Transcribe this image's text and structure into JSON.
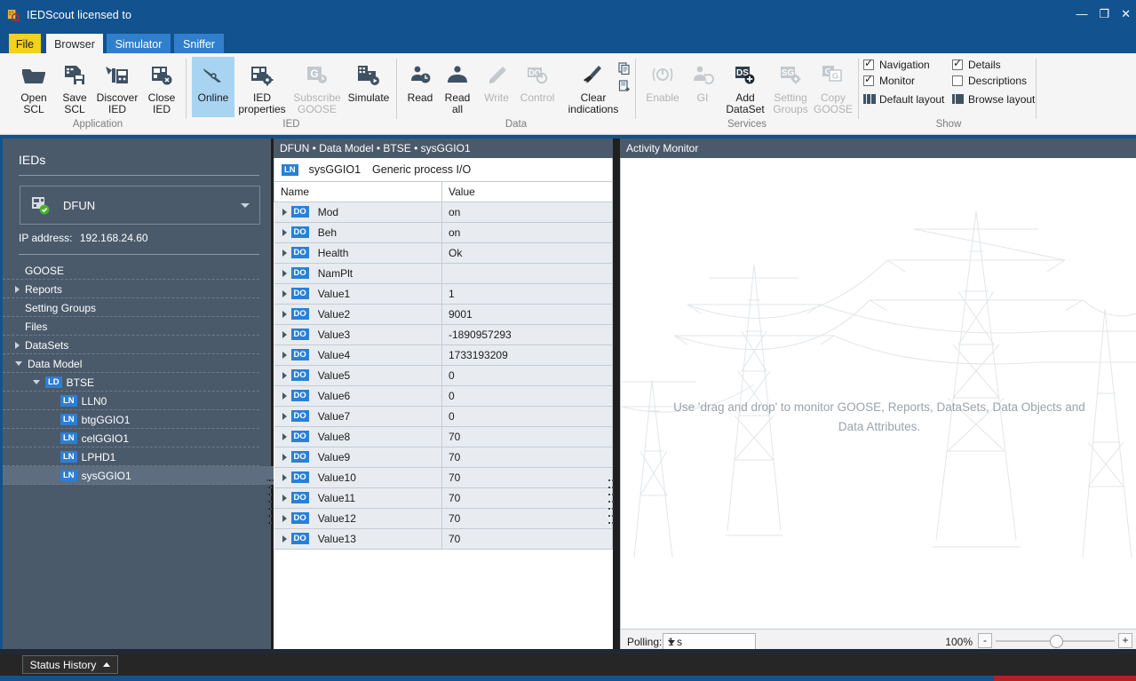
{
  "window": {
    "title": "IEDScout licensed to",
    "icon": "iedscout-logo-icon",
    "minimize": "—",
    "maximize": "❐",
    "close": "✕"
  },
  "help_bar": {
    "info": "info-icon",
    "whats_this": "whats-this-icon",
    "help": "help-icon"
  },
  "tabs": [
    {
      "label": "File",
      "state": "file"
    },
    {
      "label": "Browser",
      "state": "active"
    },
    {
      "label": "Simulator",
      "state": "normal"
    },
    {
      "label": "Sniffer",
      "state": "normal"
    }
  ],
  "ribbon": {
    "groups": [
      {
        "label": "Application"
      },
      {
        "label": "IED"
      },
      {
        "label": "Data"
      },
      {
        "label": "Services"
      },
      {
        "label": "Show"
      }
    ],
    "buttons": [
      {
        "label": "Open\nSCL",
        "icon": "open-folder-icon",
        "enabled": true,
        "selected": false
      },
      {
        "label": "Save\nSCL",
        "icon": "save-document-icon",
        "enabled": true,
        "selected": false
      },
      {
        "label": "Discover\nIED",
        "icon": "discover-ied-icon",
        "enabled": true,
        "selected": false
      },
      {
        "label": "Close\nIED",
        "icon": "close-ied-icon",
        "enabled": true,
        "selected": false
      },
      {
        "label": "Online",
        "icon": "online-plug-icon",
        "enabled": true,
        "selected": true
      },
      {
        "label": "IED\nproperties",
        "icon": "ied-properties-icon",
        "enabled": true,
        "selected": false
      },
      {
        "label": "Subscribe\nGOOSE",
        "icon": "subscribe-goose-icon",
        "enabled": false,
        "selected": false
      },
      {
        "label": "Simulate",
        "icon": "simulate-icon",
        "enabled": true,
        "selected": false
      },
      {
        "label": "Read",
        "icon": "read-icon",
        "enabled": true,
        "selected": false
      },
      {
        "label": "Read\nall",
        "icon": "read-all-icon",
        "enabled": true,
        "selected": false
      },
      {
        "label": "Write",
        "icon": "write-pencil-icon",
        "enabled": false,
        "selected": false
      },
      {
        "label": "Control",
        "icon": "control-icon",
        "enabled": false,
        "selected": false
      },
      {
        "label": "Clear\nindications",
        "icon": "clear-indications-icon",
        "enabled": true,
        "selected": false
      },
      {
        "label": "Enable",
        "icon": "enable-power-icon",
        "enabled": false,
        "selected": false
      },
      {
        "label": "GI",
        "icon": "general-interrogation-icon",
        "enabled": false,
        "selected": false
      },
      {
        "label": "Add\nDataSet",
        "icon": "add-dataset-icon",
        "enabled": true,
        "selected": false
      },
      {
        "label": "Setting\nGroups",
        "icon": "setting-groups-icon",
        "enabled": false,
        "selected": false
      },
      {
        "label": "Copy\nGOOSE",
        "icon": "copy-goose-icon",
        "enabled": false,
        "selected": false
      }
    ],
    "small_icons": [
      {
        "icon": "copy-report-icon"
      },
      {
        "icon": "export-report-icon"
      }
    ],
    "show": {
      "checkboxes": [
        {
          "label": "Navigation",
          "checked": true
        },
        {
          "label": "Details",
          "checked": true
        },
        {
          "label": "Monitor",
          "checked": true
        },
        {
          "label": "Descriptions",
          "checked": false
        }
      ],
      "layouts": [
        {
          "label": "Default layout",
          "icon": "default-layout-icon"
        },
        {
          "label": "Browse layout",
          "icon": "browse-layout-icon"
        }
      ]
    }
  },
  "sidebar": {
    "heading": "IEDs",
    "selected_ied": {
      "name": "DFUN",
      "icon": "ied-connected-icon"
    },
    "ip_label": "IP address:",
    "ip_value": "192.168.24.60",
    "tree": [
      {
        "label": "GOOSE",
        "indent": 0,
        "arrow": "none",
        "badge": "",
        "selected": false
      },
      {
        "label": "Reports",
        "indent": 0,
        "arrow": "closed",
        "badge": "",
        "selected": false
      },
      {
        "label": "Setting Groups",
        "indent": 0,
        "arrow": "none",
        "badge": "",
        "selected": false
      },
      {
        "label": "Files",
        "indent": 0,
        "arrow": "none",
        "badge": "",
        "selected": false
      },
      {
        "label": "DataSets",
        "indent": 0,
        "arrow": "closed",
        "badge": "",
        "selected": false
      },
      {
        "label": "Data Model",
        "indent": 0,
        "arrow": "open",
        "badge": "",
        "selected": false
      },
      {
        "label": "BTSE",
        "indent": 1,
        "arrow": "open",
        "badge": "LD",
        "selected": false
      },
      {
        "label": "LLN0",
        "indent": 2,
        "arrow": "none",
        "badge": "LN",
        "selected": false
      },
      {
        "label": "btgGGIO1",
        "indent": 2,
        "arrow": "none",
        "badge": "LN",
        "selected": false
      },
      {
        "label": "celGGIO1",
        "indent": 2,
        "arrow": "none",
        "badge": "LN",
        "selected": false
      },
      {
        "label": "LPHD1",
        "indent": 2,
        "arrow": "none",
        "badge": "LN",
        "selected": false
      },
      {
        "label": "sysGGIO1",
        "indent": 2,
        "arrow": "none",
        "badge": "LN",
        "selected": true
      }
    ]
  },
  "center": {
    "breadcrumb": "DFUN • Data Model • BTSE • sysGGIO1",
    "node_badge": "LN",
    "node_name": "sysGGIO1",
    "node_desc": "Generic process I/O",
    "columns": [
      "Name",
      "Value"
    ],
    "rows": [
      {
        "badge": "DO",
        "name": "Mod",
        "value": "on"
      },
      {
        "badge": "DO",
        "name": "Beh",
        "value": "on"
      },
      {
        "badge": "DO",
        "name": "Health",
        "value": "Ok"
      },
      {
        "badge": "DO",
        "name": "NamPlt",
        "value": ""
      },
      {
        "badge": "DO",
        "name": "Value1",
        "value": "1"
      },
      {
        "badge": "DO",
        "name": "Value2",
        "value": "9001"
      },
      {
        "badge": "DO",
        "name": "Value3",
        "value": "-1890957293"
      },
      {
        "badge": "DO",
        "name": "Value4",
        "value": "1733193209"
      },
      {
        "badge": "DO",
        "name": "Value5",
        "value": "0"
      },
      {
        "badge": "DO",
        "name": "Value6",
        "value": "0"
      },
      {
        "badge": "DO",
        "name": "Value7",
        "value": "0"
      },
      {
        "badge": "DO",
        "name": "Value8",
        "value": "70"
      },
      {
        "badge": "DO",
        "name": "Value9",
        "value": "70"
      },
      {
        "badge": "DO",
        "name": "Value10",
        "value": "70"
      },
      {
        "badge": "DO",
        "name": "Value11",
        "value": "70"
      },
      {
        "badge": "DO",
        "name": "Value12",
        "value": "70"
      },
      {
        "badge": "DO",
        "name": "Value13",
        "value": "70"
      }
    ]
  },
  "activity_monitor": {
    "title": "Activity Monitor",
    "hint": "Use 'drag and drop' to monitor GOOSE, Reports, DataSets, Data Objects and Data Attributes.",
    "polling_label": "Polling:",
    "polling_value": "1 s",
    "zoom_value": "100%",
    "zoom_minus": "-",
    "zoom_plus": "+"
  },
  "statusbar": {
    "status_history": "Status History",
    "caret": "▲"
  },
  "colors": {
    "brand_blue": "#11528f",
    "tab_blue": "#2f7fcc",
    "file_yellow": "#f0d31a",
    "panel_slate": "#4b5a6b",
    "selection_blue": "#a8d4f2",
    "badge_blue": "#2b7fd4",
    "accent_red": "#b52025",
    "row_gray": "#e8ecf0"
  }
}
